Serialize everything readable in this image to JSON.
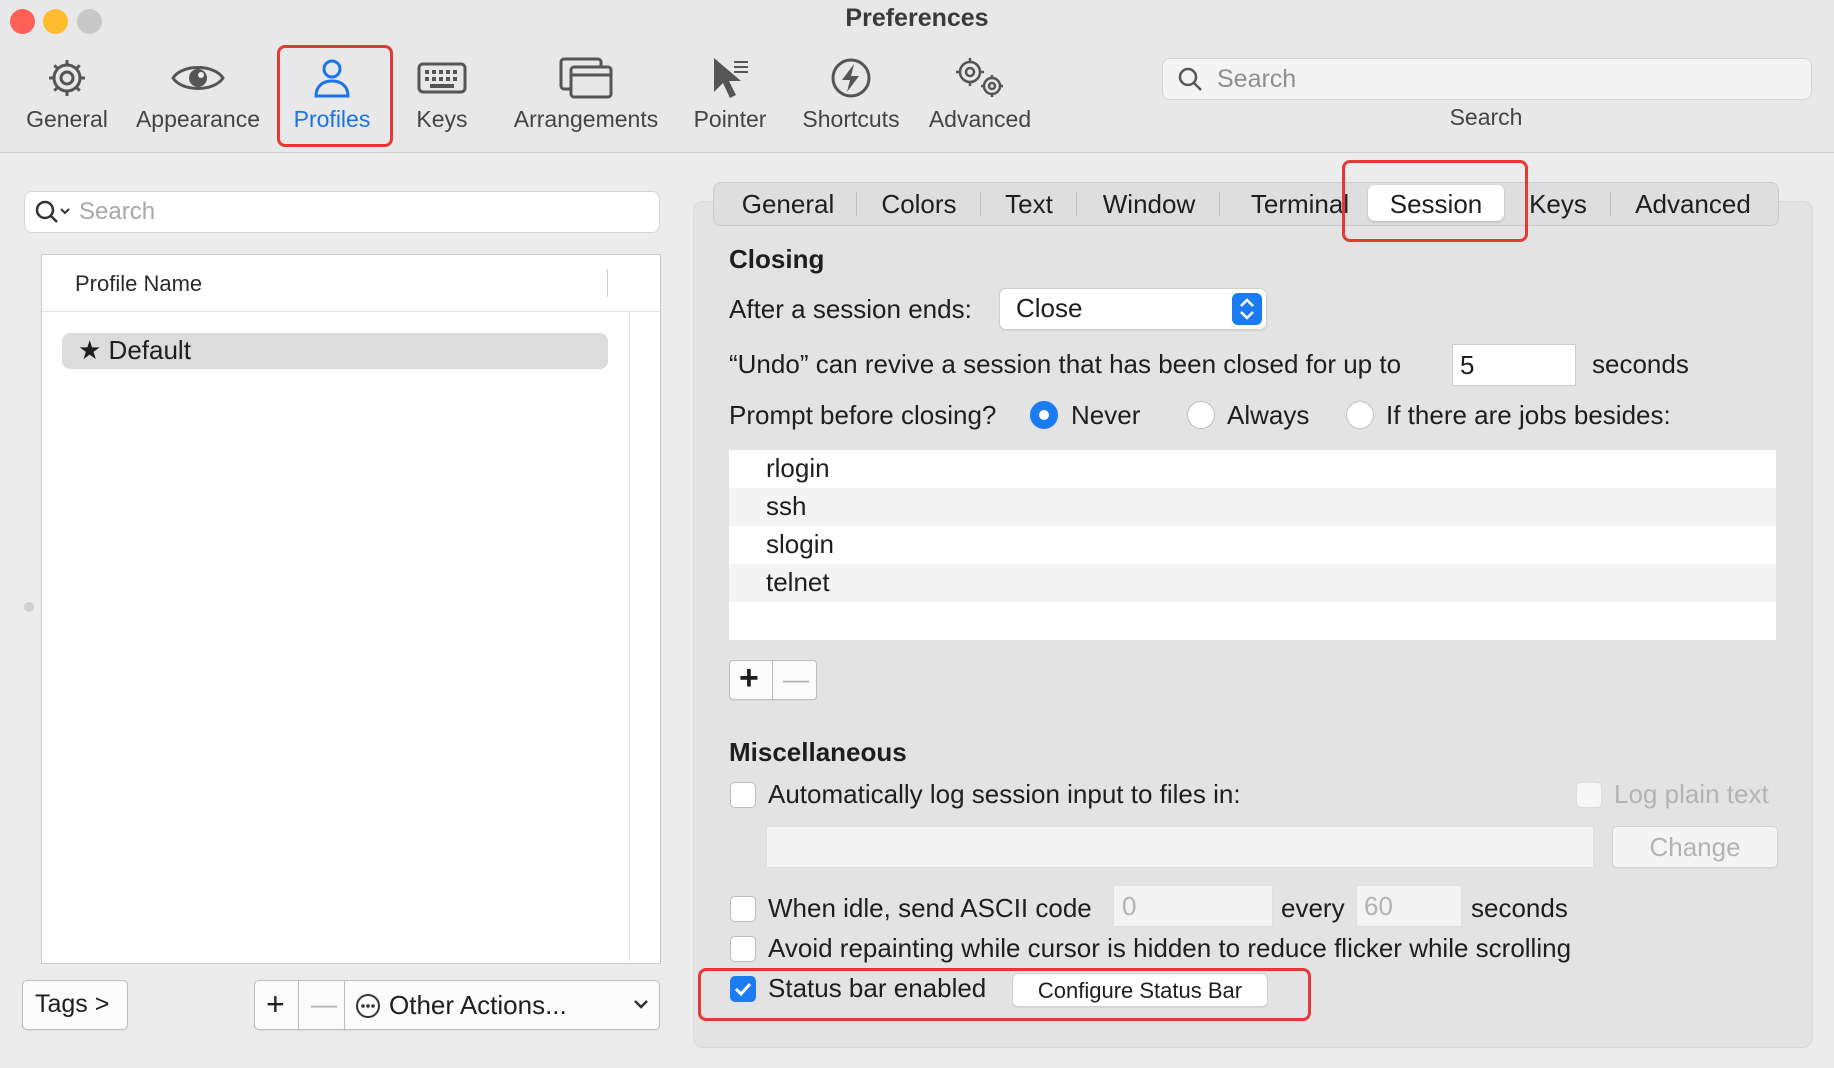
{
  "window": {
    "title": "Preferences",
    "traffic_colors": [
      "#fe5f57",
      "#febc2e",
      "#c8c8c8"
    ]
  },
  "toolbar": {
    "items": [
      {
        "label": "General",
        "icon": "gear-icon"
      },
      {
        "label": "Appearance",
        "icon": "eye-icon"
      },
      {
        "label": "Profiles",
        "icon": "person-icon",
        "active": true
      },
      {
        "label": "Keys",
        "icon": "keyboard-icon"
      },
      {
        "label": "Arrangements",
        "icon": "windows-icon"
      },
      {
        "label": "Pointer",
        "icon": "pointer-icon"
      },
      {
        "label": "Shortcuts",
        "icon": "lightning-icon"
      },
      {
        "label": "Advanced",
        "icon": "gears-icon"
      }
    ],
    "search_placeholder": "Search",
    "search_label": "Search"
  },
  "profiles_panel": {
    "search_placeholder": "Search",
    "column_header": "Profile Name",
    "profiles": [
      {
        "name": "Default",
        "icon": "star-icon",
        "selected": true
      }
    ],
    "tags_button": "Tags >",
    "add_button": "+",
    "remove_button": "—",
    "other_actions": "Other Actions..."
  },
  "tabs": [
    "General",
    "Colors",
    "Text",
    "Window",
    "Terminal",
    "Session",
    "Keys",
    "Advanced"
  ],
  "active_tab": "Session",
  "closing": {
    "title": "Closing",
    "after_session_label": "After a session ends:",
    "after_session_value": "Close",
    "undo_label": "“Undo” can revive a session that has been closed for up to",
    "undo_value": "5",
    "undo_unit": "seconds",
    "prompt_label": "Prompt before closing?",
    "prompt_options": [
      "Never",
      "Always",
      "If there are jobs besides:"
    ],
    "prompt_selected": "Never",
    "jobs": [
      "rlogin",
      "ssh",
      "slogin",
      "telnet"
    ],
    "add_job": "+",
    "remove_job": "—"
  },
  "misc": {
    "title": "Miscellaneous",
    "auto_log_label": "Automatically log session input to files in:",
    "log_plain_label": "Log plain text",
    "change_button": "Change",
    "idle_label": "When idle, send ASCII code",
    "idle_code": "0",
    "every_label": "every",
    "idle_interval": "60",
    "seconds_label": "seconds",
    "avoid_repaint_label": "Avoid repainting while cursor is hidden to reduce flicker while scrolling",
    "status_bar_label": "Status bar enabled",
    "status_bar_checked": true,
    "configure_button": "Configure Status Bar"
  },
  "colors": {
    "accent": "#1b7bf2",
    "highlight": "#e53935",
    "active_label": "#1a73e8"
  }
}
